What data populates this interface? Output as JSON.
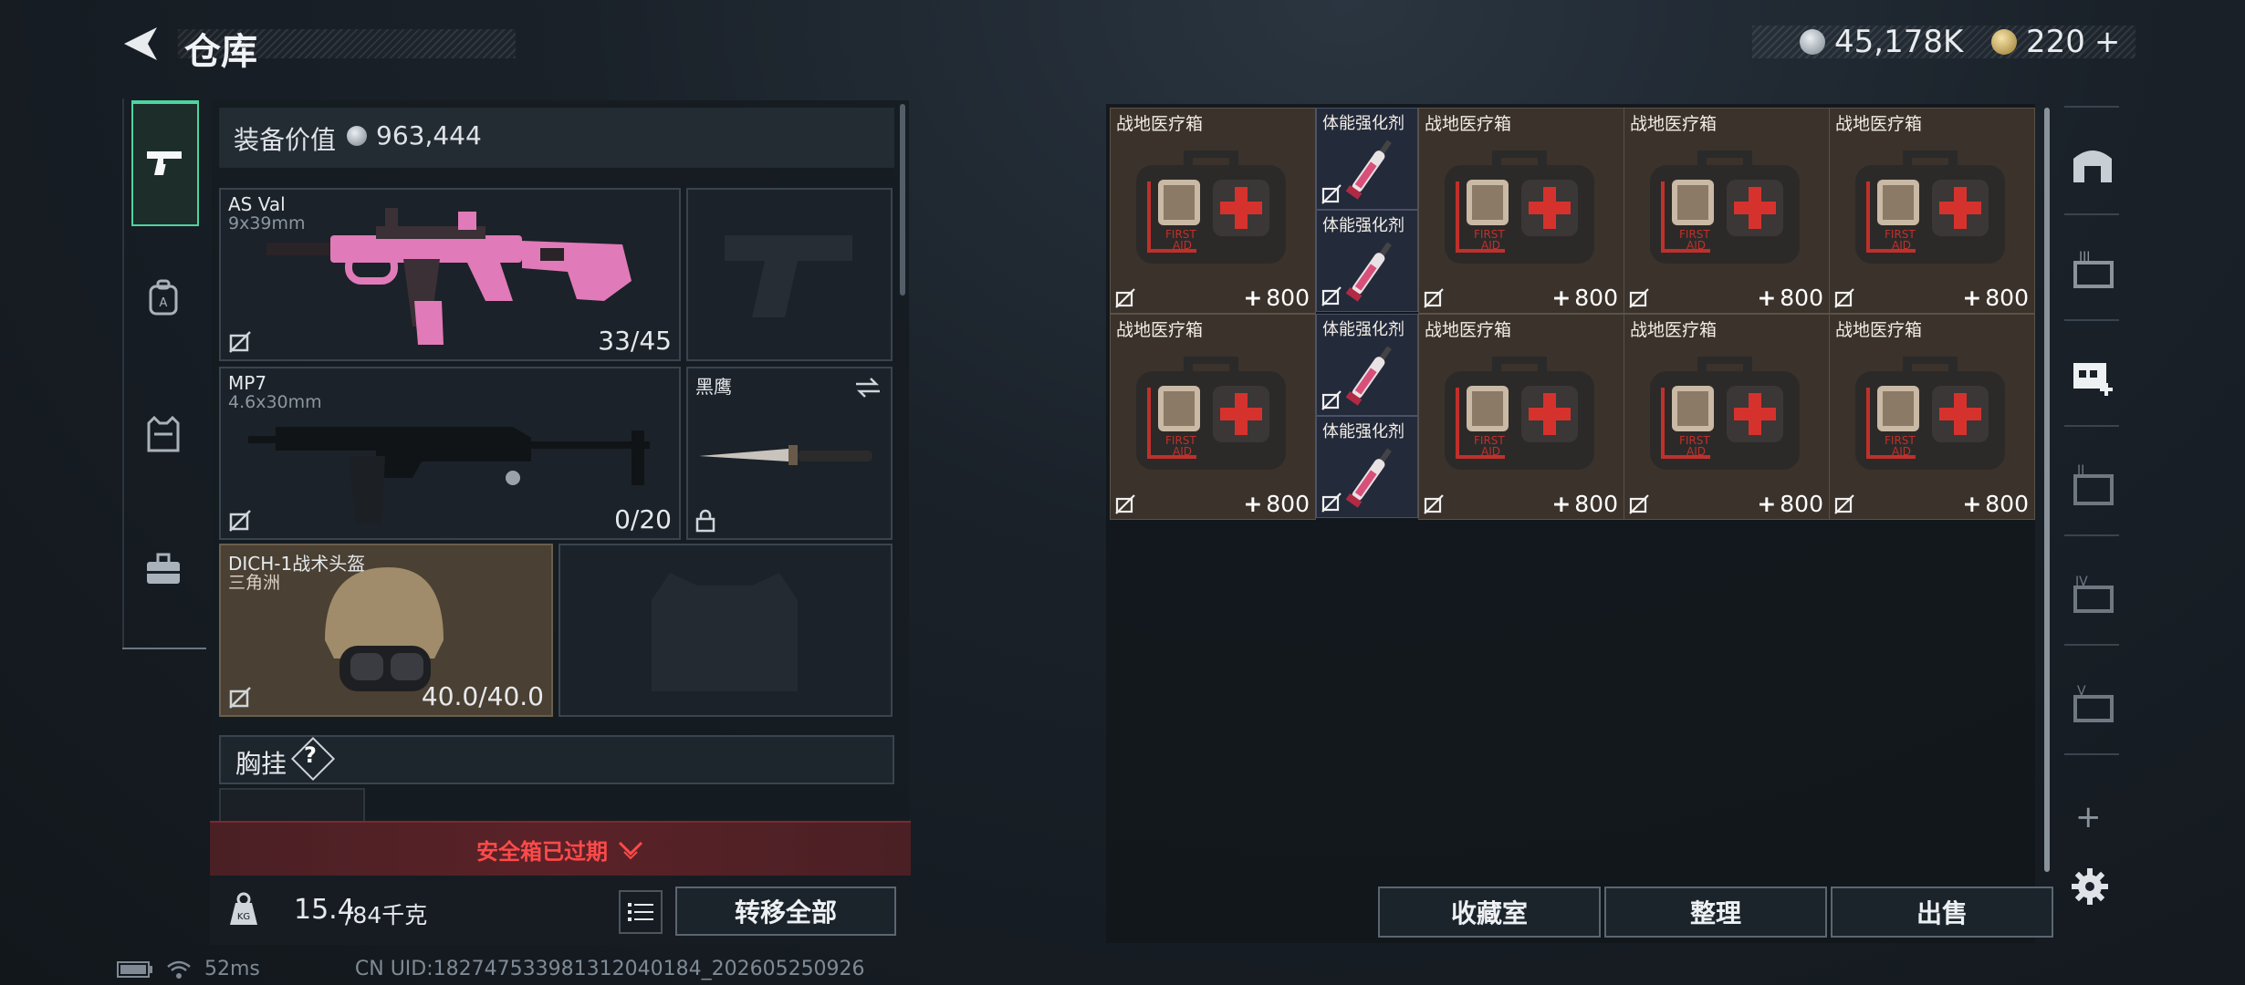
{
  "header": {
    "title": "仓库",
    "currency_main": "45,178K",
    "currency_second": "220",
    "currency_second_suffix": "+"
  },
  "equipment": {
    "value_label": "装备价值",
    "value": "963,444",
    "primary": {
      "name": "AS Val",
      "caliber": "9x39mm",
      "ammo": "33/45"
    },
    "secondary": {
      "name": "MP7",
      "caliber": "4.6x30mm",
      "ammo": "0/20"
    },
    "melee": {
      "name": "黑鹰"
    },
    "helmet": {
      "name": "DICH-1战术头盔",
      "brand": "三角洲",
      "durability": "40.0/40.0"
    },
    "chest_label": "胸挂",
    "chest_help": "?",
    "safebox_expired": "安全箱已过期",
    "weight_current": "15.4",
    "weight_max": "/84千克",
    "transfer_all": "转移全部"
  },
  "inventory": {
    "cells": [
      {
        "name": "战地医疗箱",
        "amount": "800",
        "kind": "medkit"
      },
      {
        "name": "体能强化剂",
        "amount": "",
        "kind": "syringe"
      },
      {
        "name": "体能强化剂",
        "amount": "",
        "kind": "syringe"
      },
      {
        "name": "战地医疗箱",
        "amount": "800",
        "kind": "medkit"
      },
      {
        "name": "战地医疗箱",
        "amount": "800",
        "kind": "medkit"
      },
      {
        "name": "战地医疗箱",
        "amount": "800",
        "kind": "medkit"
      },
      {
        "name": "战地医疗箱",
        "amount": "800",
        "kind": "medkit"
      },
      {
        "name": "体能强化剂",
        "amount": "",
        "kind": "syringe"
      },
      {
        "name": "体能强化剂",
        "amount": "",
        "kind": "syringe"
      },
      {
        "name": "战地医疗箱",
        "amount": "800",
        "kind": "medkit"
      },
      {
        "name": "战地医疗箱",
        "amount": "800",
        "kind": "medkit"
      },
      {
        "name": "战地医疗箱",
        "amount": "800",
        "kind": "medkit"
      }
    ],
    "amount_prefix": "+",
    "buttons": {
      "collection": "收藏室",
      "sort": "整理",
      "sell": "出售"
    },
    "add_label": "+"
  },
  "status": {
    "ping": "52ms",
    "uid": "CN UID:1827475339813120401​84_202605250926"
  },
  "colors": {
    "accent_green": "#4fd4a0",
    "alert_red": "#ff4a4a",
    "medkit_bg": "#3a322b",
    "helmet_bg": "#4a4033"
  }
}
